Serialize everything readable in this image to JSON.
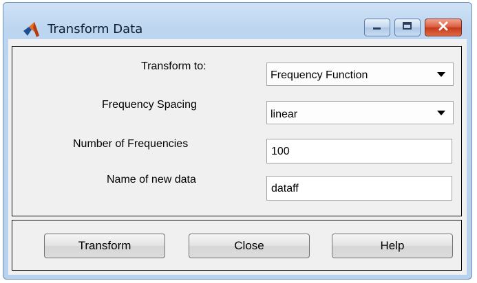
{
  "window": {
    "title": "Transform Data",
    "controls": [
      "minimize-icon",
      "maximize-icon",
      "close-icon"
    ]
  },
  "form": {
    "transform_to": {
      "label": "Transform to:",
      "value": "Frequency Function"
    },
    "frequency_spacing": {
      "label": "Frequency Spacing",
      "value": "linear"
    },
    "num_frequencies": {
      "label": "Number of Frequencies",
      "value": "100"
    },
    "new_data_name": {
      "label": "Name of new data",
      "value": "dataff"
    }
  },
  "buttons": {
    "transform": "Transform",
    "close": "Close",
    "help": "Help"
  },
  "colors": {
    "title_bar": "#bcd5f0",
    "dialog_background": "#f0f0f0",
    "close_button": "#c4391a"
  }
}
